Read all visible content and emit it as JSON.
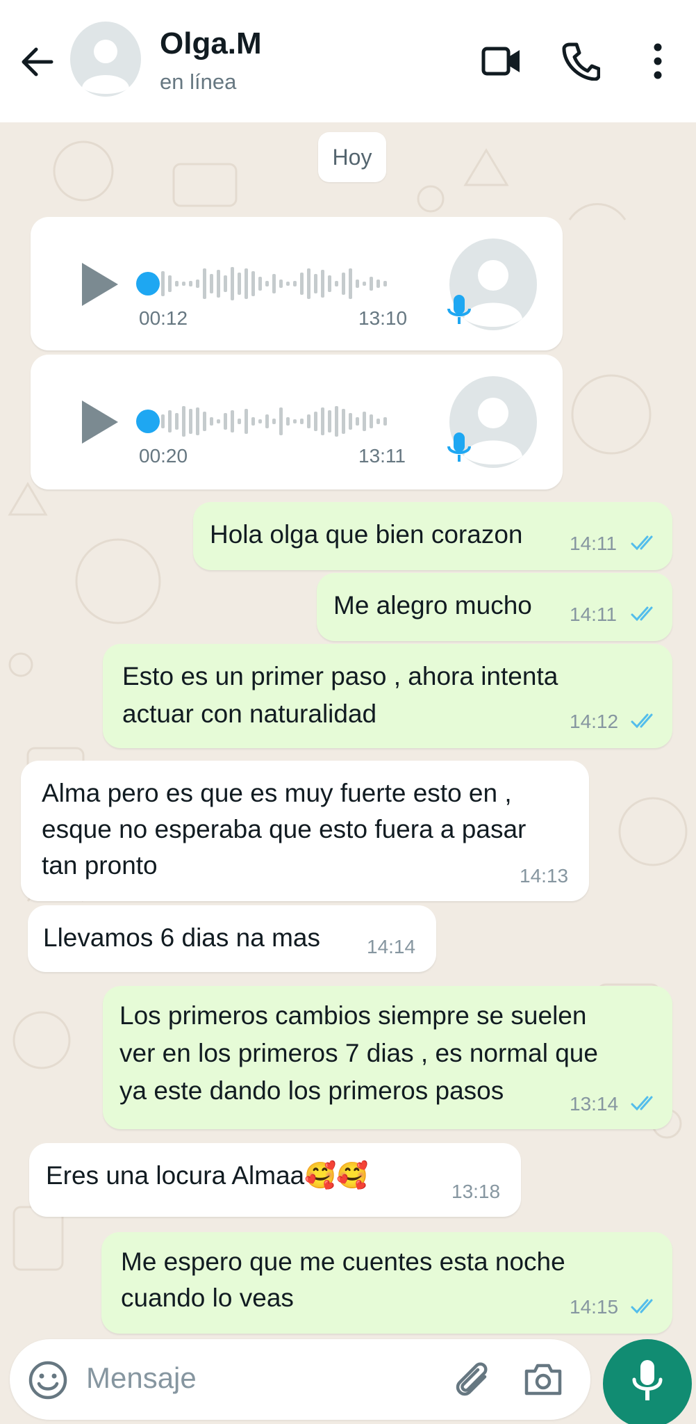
{
  "header": {
    "contact_name": "Olga.M",
    "status": "en línea",
    "icons": [
      "back-arrow-icon",
      "avatar",
      "video-call-icon",
      "phone-icon",
      "more-options-icon"
    ]
  },
  "date_chip": "Hoy",
  "audio_messages": [
    {
      "duration": "00:12",
      "time": "13:10",
      "icon": "play-icon"
    },
    {
      "duration": "00:20",
      "time": "13:11",
      "icon": "play-icon"
    }
  ],
  "messages": [
    {
      "dir": "out",
      "lines": [
        "Hola olga que bien corazon"
      ],
      "time": "14:11",
      "status": "read"
    },
    {
      "dir": "out",
      "lines": [
        "Me alegro mucho"
      ],
      "time": "14:11",
      "status": "read"
    },
    {
      "dir": "out",
      "lines": [
        "Esto es un primer paso , ahora intenta",
        "actuar con naturalidad"
      ],
      "time": "14:12",
      "status": "read"
    },
    {
      "dir": "in",
      "lines": [
        "Alma pero es que es muy fuerte esto en ,",
        "esque no esperaba que esto fuera a pasar",
        "tan pronto"
      ],
      "time": "14:13"
    },
    {
      "dir": "in",
      "lines": [
        "Llevamos 6 dias na mas"
      ],
      "time": "14:14"
    },
    {
      "dir": "out",
      "lines": [
        "Los primeros cambios siempre se suelen",
        "ver en los primeros 7 dias , es normal que",
        "ya este dando los primeros pasos"
      ],
      "time": "13:14",
      "status": "read"
    },
    {
      "dir": "in",
      "lines": [
        "Eres una locura Almaa🥰🥰"
      ],
      "time": "13:18"
    },
    {
      "dir": "out",
      "lines": [
        "Me espero que me cuentes esta noche",
        "cuando lo veas"
      ],
      "time": "14:15",
      "status": "read"
    }
  ],
  "composer": {
    "placeholder": "Mensaje",
    "icons": [
      "emoji-icon",
      "attach-icon",
      "camera-icon",
      "mic-icon"
    ]
  },
  "colors": {
    "header_bg": "#ffffff",
    "chat_bg": "#f1ebe3",
    "outgoing_bubble": "#e6fbd7",
    "incoming_bubble": "#ffffff",
    "read_ticks": "#53bdeb",
    "audio_accent": "#1ea7f2",
    "mic_fab": "#118c72"
  }
}
